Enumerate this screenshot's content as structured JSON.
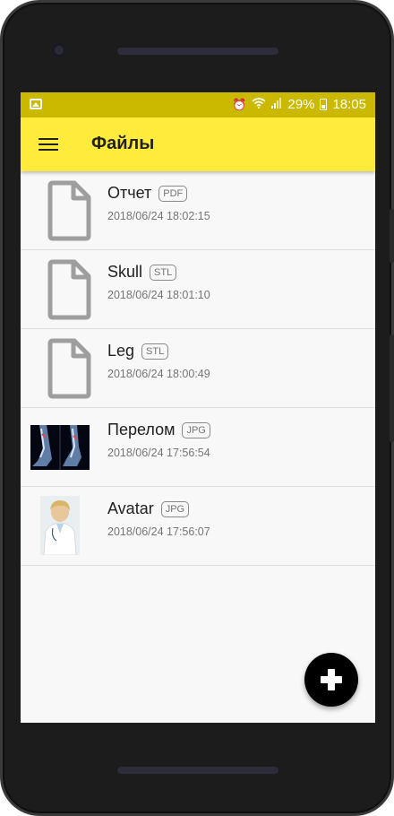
{
  "status_bar": {
    "battery_percent": "29%",
    "time": "18:05",
    "icons": [
      "image-icon",
      "alarm-icon",
      "wifi-icon",
      "signal-icon",
      "battery-icon"
    ]
  },
  "app_bar": {
    "title": "Файлы",
    "menu_icon": "menu-icon"
  },
  "colors": {
    "status_bar": "#cbb900",
    "app_bar": "#ffeb3b",
    "fab": "#000000",
    "list_bg": "#f8f8f8"
  },
  "files": [
    {
      "name": "Отчет",
      "type": "PDF",
      "date": "2018/06/24 18:02:15",
      "thumbnail": "document-icon"
    },
    {
      "name": "Skull",
      "type": "STL",
      "date": "2018/06/24 18:01:10",
      "thumbnail": "document-icon"
    },
    {
      "name": "Leg",
      "type": "STL",
      "date": "2018/06/24 18:00:49",
      "thumbnail": "document-icon"
    },
    {
      "name": "Перелом",
      "type": "JPG",
      "date": "2018/06/24 17:56:54",
      "thumbnail": "xray-photo"
    },
    {
      "name": "Avatar",
      "type": "JPG",
      "date": "2018/06/24 17:56:07",
      "thumbnail": "doctor-photo"
    }
  ],
  "fab": {
    "icon": "plus-icon"
  }
}
